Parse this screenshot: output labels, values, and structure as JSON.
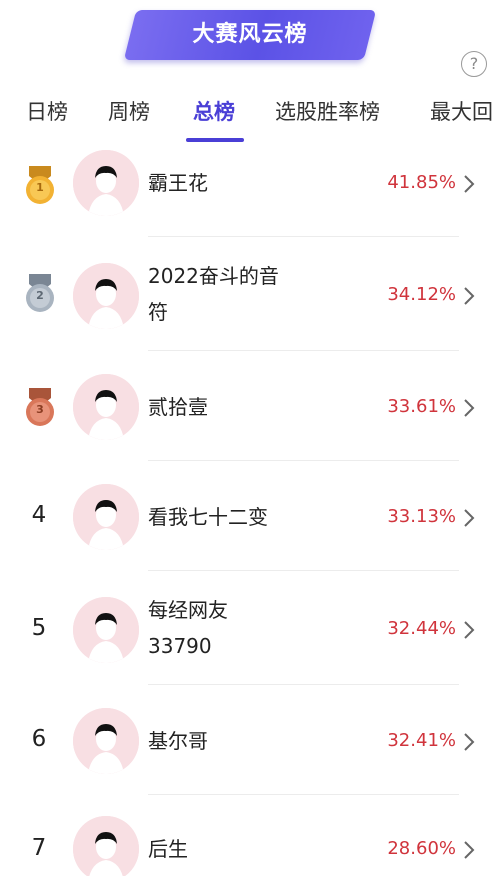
{
  "banner": {
    "title": "大赛风云榜"
  },
  "help_icon": "?",
  "tabs": [
    {
      "label": "日榜",
      "active": false
    },
    {
      "label": "周榜",
      "active": false
    },
    {
      "label": "总榜",
      "active": true
    },
    {
      "label": "选股胜率榜",
      "active": false
    },
    {
      "label": "最大回",
      "active": false
    }
  ],
  "colors": {
    "accent": "#4a3fd6",
    "percent": "#d0343c",
    "banner": "#6a5ef0"
  },
  "rows": [
    {
      "rank": "1",
      "medal": "gold",
      "name_line1": "霸王花",
      "name_line2": "",
      "percent": "41.85%"
    },
    {
      "rank": "2",
      "medal": "silver",
      "name_line1": "2022奋斗的音",
      "name_line2": "符",
      "percent": "34.12%"
    },
    {
      "rank": "3",
      "medal": "bronze",
      "name_line1": "贰拾壹",
      "name_line2": "",
      "percent": "33.61%"
    },
    {
      "rank": "4",
      "medal": "",
      "name_line1": "看我七十二变",
      "name_line2": "",
      "percent": "33.13%"
    },
    {
      "rank": "5",
      "medal": "",
      "name_line1": "每经网友",
      "name_line2": "33790",
      "percent": "32.44%"
    },
    {
      "rank": "6",
      "medal": "",
      "name_line1": "基尔哥",
      "name_line2": "",
      "percent": "32.41%"
    },
    {
      "rank": "7",
      "medal": "",
      "name_line1": "后生",
      "name_line2": "",
      "percent": "28.60%"
    }
  ]
}
